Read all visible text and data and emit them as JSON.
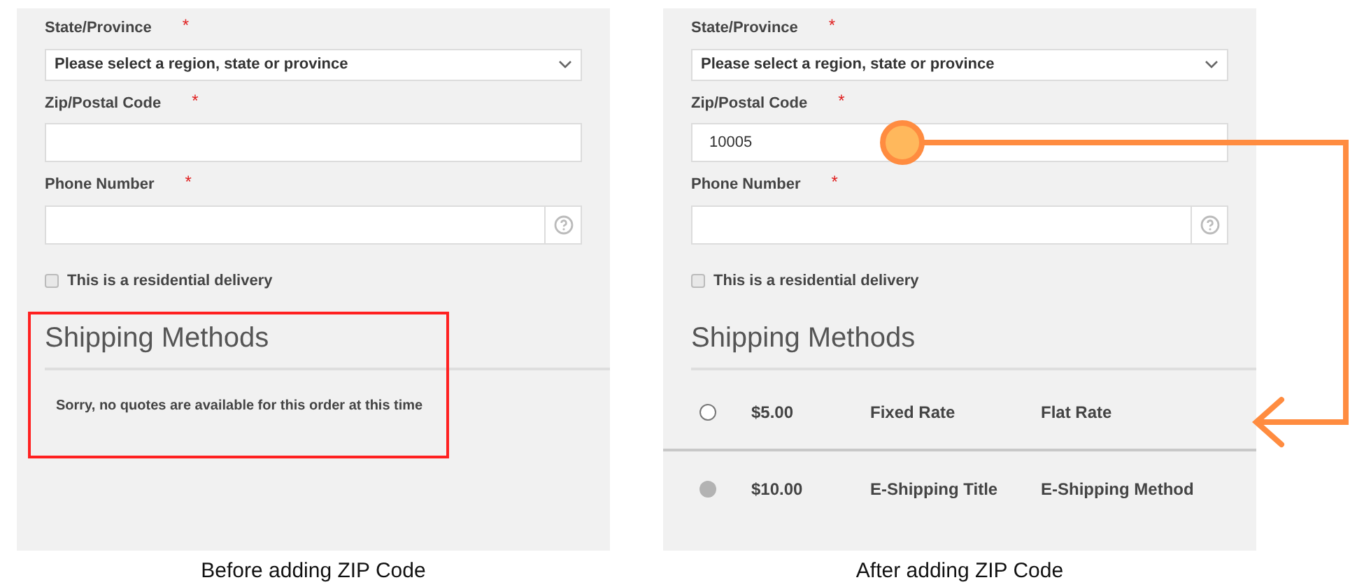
{
  "panels": [
    {
      "caption": "Before adding ZIP Code",
      "fields": [
        {
          "kind": "select",
          "label": "State/Province",
          "required_mark": "*",
          "value": "Please select a region, state or province"
        },
        {
          "kind": "text",
          "label": "Zip/Postal Code",
          "required_mark": "*"
        },
        {
          "kind": "help",
          "label": "Phone Number",
          "required_mark": "*"
        }
      ],
      "checkbox": {
        "label": "This is a residential delivery",
        "checked": false
      },
      "section_title": "Shipping Methods",
      "message": "Sorry, no quotes are available for this order at this time"
    },
    {
      "caption": "After adding ZIP Code",
      "fields": [
        {
          "kind": "select",
          "label": "State/Province",
          "required_mark": "*",
          "value": "Please select a region, state or province"
        },
        {
          "kind": "text",
          "label": "Zip/Postal Code",
          "required_mark": "*",
          "value": "10005"
        },
        {
          "kind": "help",
          "label": "Phone Number",
          "required_mark": "*"
        }
      ],
      "checkbox": {
        "label": "This is a residential delivery",
        "checked": false
      },
      "section_title": "Shipping Methods",
      "methods": [
        {
          "price": "$5.00",
          "title": "Fixed Rate",
          "method": "Flat Rate",
          "selected": false
        },
        {
          "price": "$10.00",
          "title": "E-Shipping Title",
          "method": "E-Shipping Method",
          "selected": true
        }
      ]
    }
  ]
}
